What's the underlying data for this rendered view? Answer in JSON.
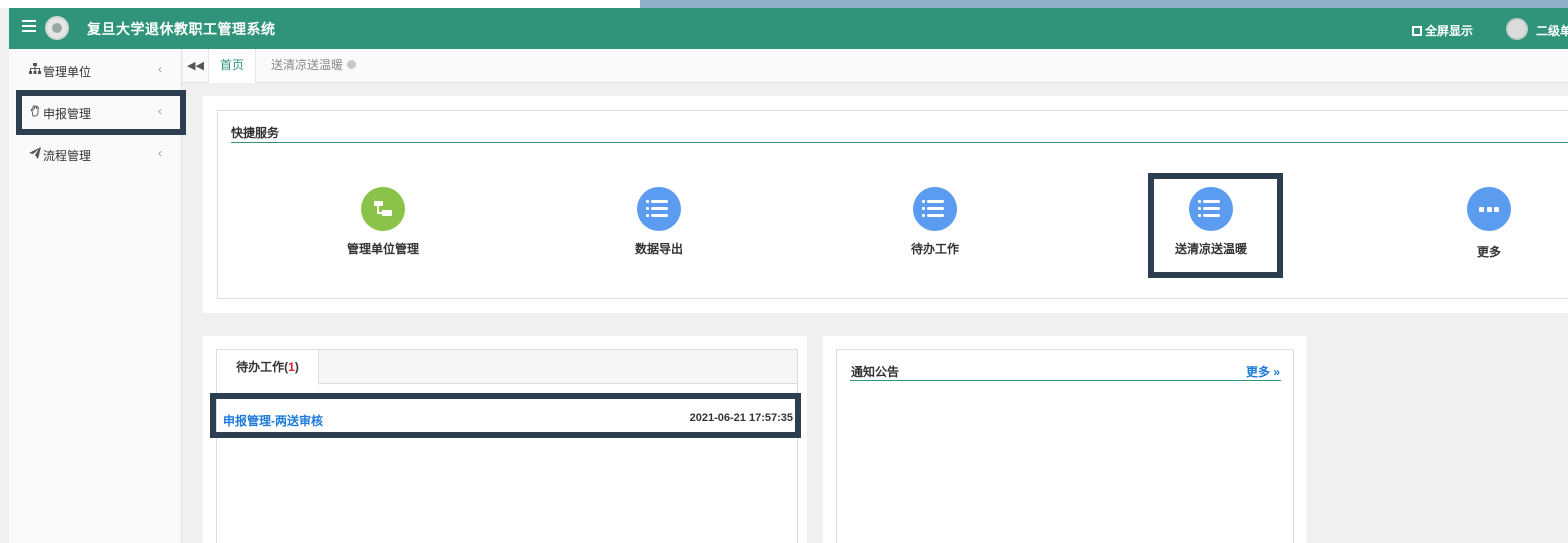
{
  "header": {
    "title": "复旦大学退休教职工管理系统",
    "fullscreen_label": "全屏显示",
    "user_label": "二级单"
  },
  "sidebar": {
    "items": [
      {
        "label": "管理单位",
        "icon": "sitemap-icon"
      },
      {
        "label": "申报管理",
        "icon": "hand-icon"
      },
      {
        "label": "流程管理",
        "icon": "paper-plane-icon"
      }
    ]
  },
  "tabs": {
    "items": [
      {
        "label": "首页"
      },
      {
        "label": "送清凉送温暖"
      }
    ]
  },
  "quick_services": {
    "title": "快捷服务",
    "items": [
      {
        "label": "管理单位管理",
        "icon": "hierarchy-icon",
        "color": "#8bc34a"
      },
      {
        "label": "数据导出",
        "icon": "list-icon",
        "color": "#5b9cf0"
      },
      {
        "label": "待办工作",
        "icon": "list-icon",
        "color": "#5b9cf0"
      },
      {
        "label": "送清凉送温暖",
        "icon": "list-icon",
        "color": "#5b9cf0"
      },
      {
        "label": "更多",
        "icon": "ellipsis-icon",
        "color": "#5b9cf0"
      }
    ]
  },
  "todo": {
    "tab_label": "待办工作(",
    "tab_count": "1",
    "tab_close": ")",
    "rows": [
      {
        "name": "申报管理-两送审核",
        "time": "2021-06-21 17:57:35"
      }
    ]
  },
  "notice": {
    "title": "通知公告",
    "more_label": "更多 »"
  },
  "colors": {
    "brand": "#2f9479",
    "link": "#1e7bd9",
    "highlight_border": "#2d3e50"
  }
}
